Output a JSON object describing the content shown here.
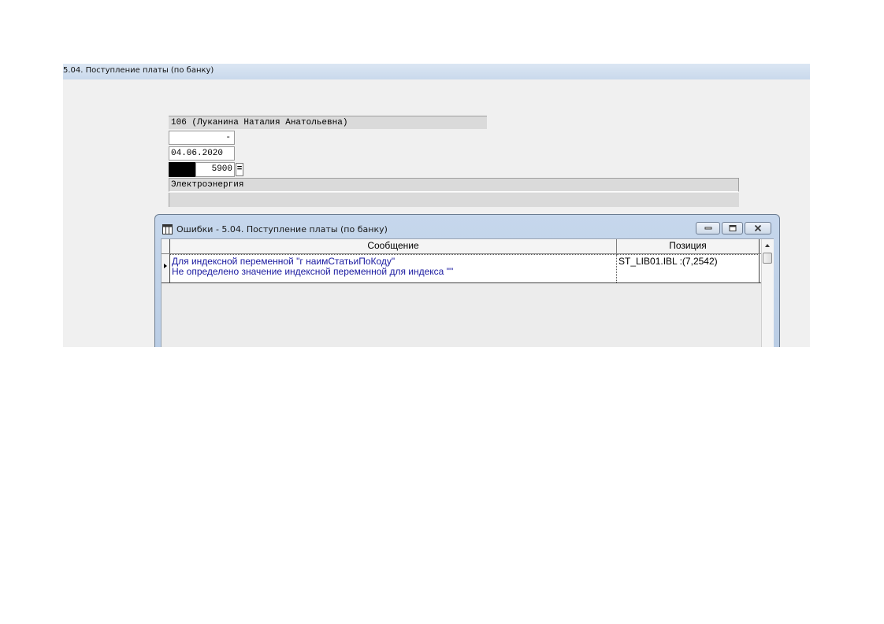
{
  "window": {
    "title": "5.04. Поступление платы (по банку)"
  },
  "form": {
    "payer": "106 (Луканина Наталия Анатольевна)",
    "number": "-",
    "date": "04.06.2020",
    "amount": "5900",
    "calc_button": "=",
    "article": "Электроэнергия",
    "extra": ""
  },
  "error_dialog": {
    "title": "Ошибки -  5.04. Поступление платы (по банку)",
    "columns": {
      "message": "Сообщение",
      "position": "Позиция"
    },
    "rows": [
      {
        "message_line1": "Для индексной переменной \"г наимСтатьиПоКоду\"",
        "message_line2": "Не определено значение индексной переменной для индекса \"\"",
        "position": "ST_LIB01.IBL :(7,2542)"
      }
    ]
  }
}
